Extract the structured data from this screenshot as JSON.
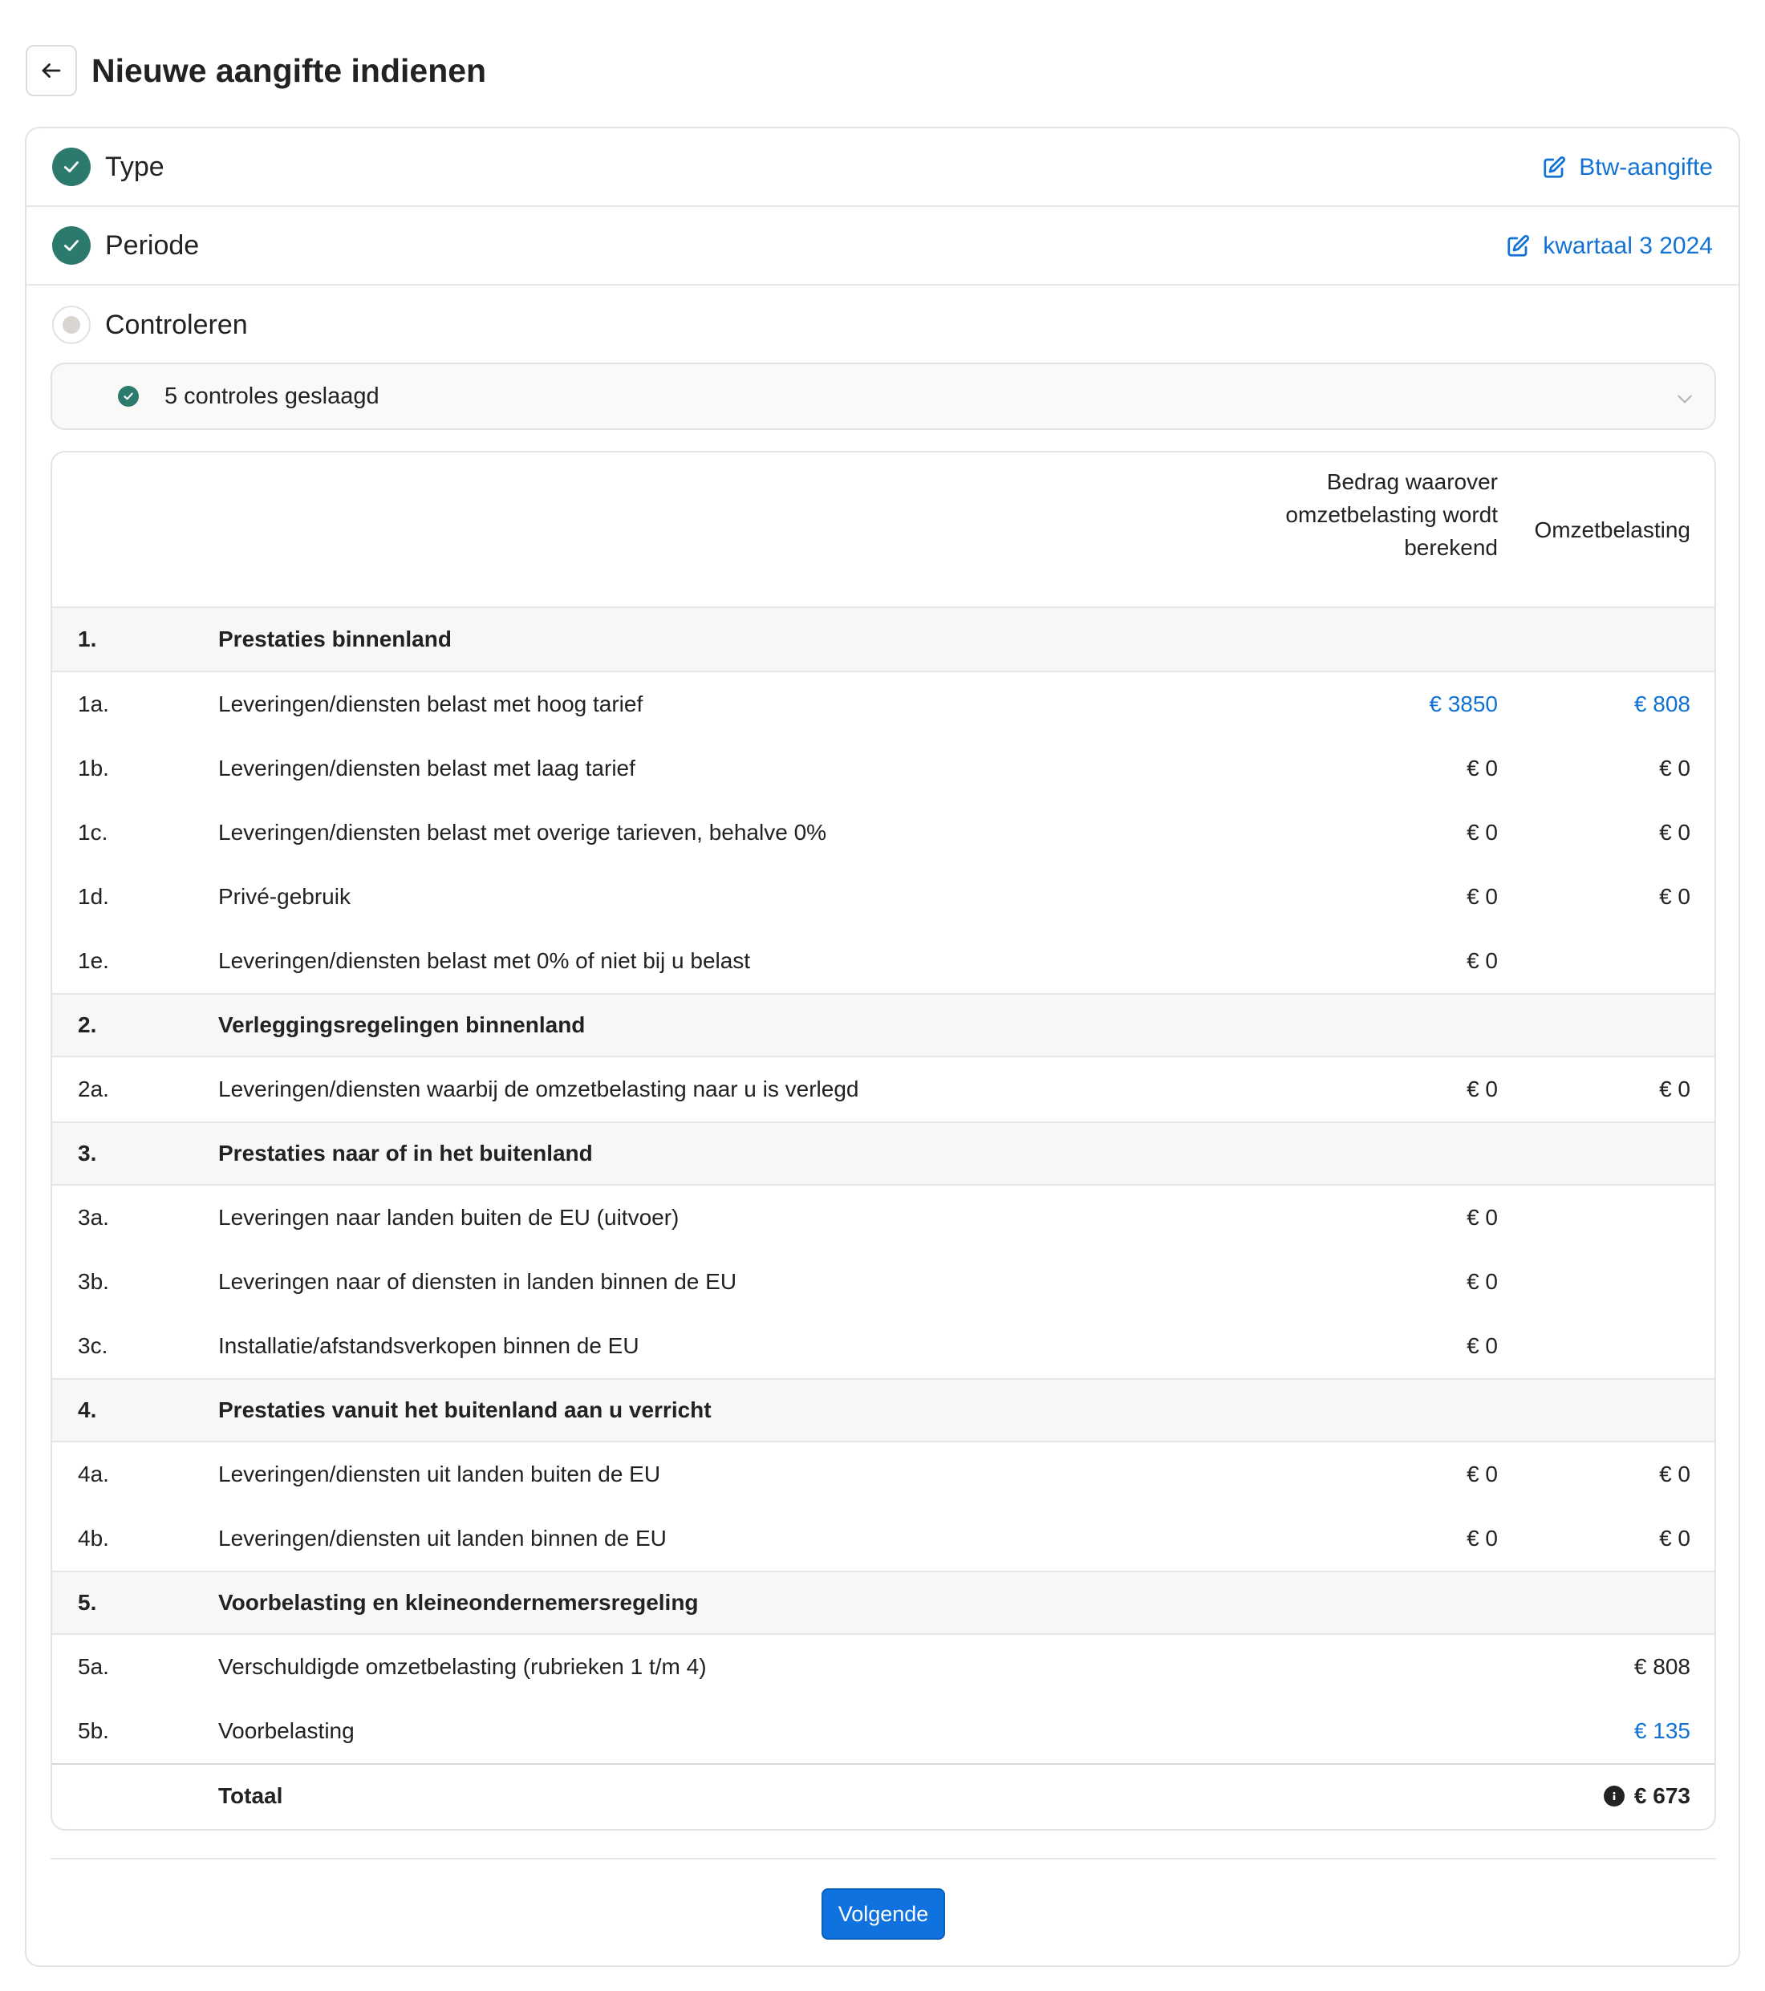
{
  "header": {
    "title": "Nieuwe aangifte indienen"
  },
  "steps": [
    {
      "label": "Type",
      "value": "Btw-aangifte",
      "status": "done"
    },
    {
      "label": "Periode",
      "value": "kwartaal 3 2024",
      "status": "done"
    },
    {
      "label": "Controleren",
      "value": "",
      "status": "pending"
    }
  ],
  "checks": {
    "text": "5 controles geslaagd"
  },
  "table": {
    "col_amount": "Bedrag waarover omzetbelasting wordt berekend",
    "col_tax": "Omzetbelasting",
    "rows": [
      {
        "code": "1.",
        "desc": "Prestaties binnenland",
        "amount": "",
        "tax": ""
      },
      {
        "code": "1a.",
        "desc": "Leveringen/diensten belast met hoog tarief",
        "amount": "€ 3850",
        "tax": "€ 808"
      },
      {
        "code": "1b.",
        "desc": "Leveringen/diensten belast met laag tarief",
        "amount": "€ 0",
        "tax": "€ 0"
      },
      {
        "code": "1c.",
        "desc": "Leveringen/diensten belast met overige tarieven, behalve 0%",
        "amount": "€ 0",
        "tax": "€ 0"
      },
      {
        "code": "1d.",
        "desc": "Privé-gebruik",
        "amount": "€ 0",
        "tax": "€ 0"
      },
      {
        "code": "1e.",
        "desc": "Leveringen/diensten belast met 0% of niet bij u belast",
        "amount": "€ 0",
        "tax": ""
      },
      {
        "code": "2.",
        "desc": "Verleggingsregelingen binnenland",
        "amount": "",
        "tax": ""
      },
      {
        "code": "2a.",
        "desc": "Leveringen/diensten waarbij de omzetbelasting naar u is verlegd",
        "amount": "€ 0",
        "tax": "€ 0"
      },
      {
        "code": "3.",
        "desc": "Prestaties naar of in het buitenland",
        "amount": "",
        "tax": ""
      },
      {
        "code": "3a.",
        "desc": "Leveringen naar landen buiten de EU (uitvoer)",
        "amount": "€ 0",
        "tax": ""
      },
      {
        "code": "3b.",
        "desc": "Leveringen naar of diensten in landen binnen de EU",
        "amount": "€ 0",
        "tax": ""
      },
      {
        "code": "3c.",
        "desc": "Installatie/afstandsverkopen binnen de EU",
        "amount": "€ 0",
        "tax": ""
      },
      {
        "code": "4.",
        "desc": "Prestaties vanuit het buitenland aan u verricht",
        "amount": "",
        "tax": ""
      },
      {
        "code": "4a.",
        "desc": "Leveringen/diensten uit landen buiten de EU",
        "amount": "€ 0",
        "tax": "€ 0"
      },
      {
        "code": "4b.",
        "desc": "Leveringen/diensten uit landen binnen de EU",
        "amount": "€ 0",
        "tax": "€ 0"
      },
      {
        "code": "5.",
        "desc": "Voorbelasting en kleineondernemersregeling",
        "amount": "",
        "tax": ""
      },
      {
        "code": "5a.",
        "desc": "Verschuldigde omzetbelasting (rubrieken 1 t/m 4)",
        "amount": "",
        "tax": "€ 808"
      },
      {
        "code": "5b.",
        "desc": "Voorbelasting",
        "amount": "",
        "tax": "€ 135"
      }
    ],
    "total": {
      "label": "Totaal",
      "value": "€ 673"
    }
  },
  "footer": {
    "next_label": "Volgende"
  },
  "colors": {
    "accent": "#1172d4",
    "success": "#2c7a6e",
    "section_bg": "#f8f7f6"
  }
}
